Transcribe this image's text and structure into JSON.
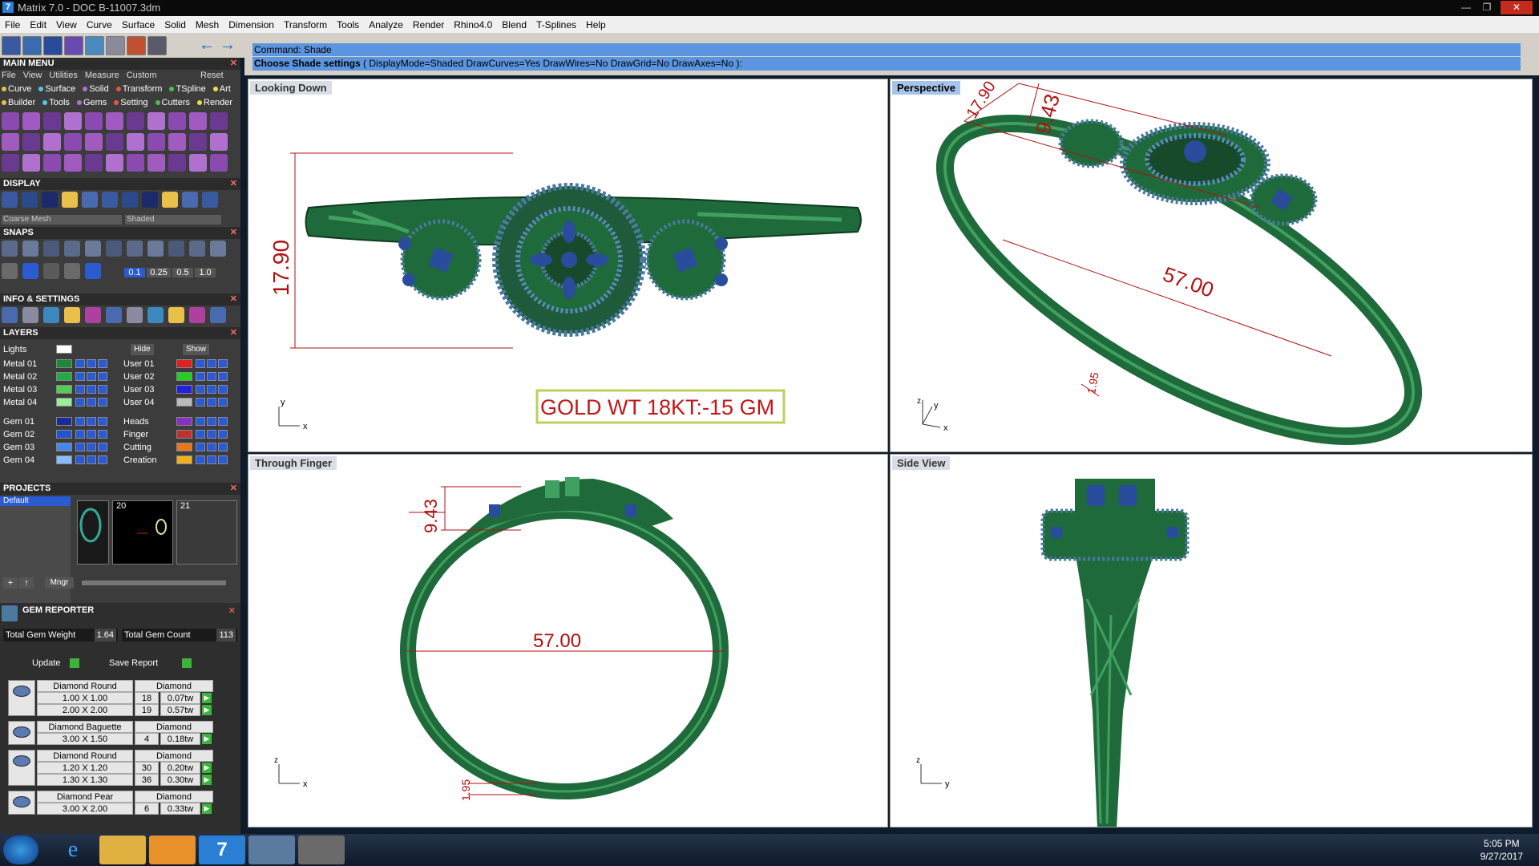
{
  "window": {
    "title": "Matrix 7.0 - DOC B-11007.3dm",
    "app_icon": "matrix-logo-icon",
    "controls": [
      "minimize-icon",
      "restore-icon",
      "close-icon"
    ]
  },
  "menubar": [
    "File",
    "Edit",
    "View",
    "Curve",
    "Surface",
    "Solid",
    "Mesh",
    "Dimension",
    "Transform",
    "Tools",
    "Analyze",
    "Render",
    "Rhino4.0",
    "Blend",
    "T-Splines",
    "Help"
  ],
  "toolbar": {
    "icons": [
      "new-file-icon",
      "open-file-icon",
      "render-icon",
      "curve-icon",
      "shade-icon",
      "viewport-icon",
      "gem-icon",
      "tool-icon"
    ],
    "nav": [
      "back-arrow-icon",
      "forward-arrow-icon"
    ]
  },
  "command": {
    "line1": "Command: Shade",
    "prompt": "Choose Shade settings",
    "options": "( DisplayMode=Shaded  DrawCurves=Yes  DrawWires=No  DrawGrid=No  DrawAxes=No ):"
  },
  "main_menu": {
    "title": "MAIN MENU",
    "tabs": [
      "File",
      "View",
      "Utilities",
      "Measure",
      "Custom"
    ],
    "reset": "Reset",
    "builders_row1": [
      "Curve",
      "Surface",
      "Solid",
      "Transform",
      "TSpline",
      "Art"
    ],
    "builders_row2": [
      "Builder",
      "Tools",
      "Gems",
      "Setting",
      "Cutters",
      "Render"
    ],
    "dot_colors": [
      "#e8c04a",
      "#57c6e0",
      "#b070d0",
      "#e05a3a",
      "#4ac04a",
      "#e8e04a"
    ]
  },
  "display": {
    "title": "DISPLAY",
    "mesh_select": "Coarse Mesh",
    "shade_select": "Shaded"
  },
  "snaps": {
    "title": "SNAPS",
    "values": [
      "0.1",
      "0.25",
      "0.5",
      "1.0"
    ]
  },
  "info_settings": {
    "title": "INFO & SETTINGS"
  },
  "layers": {
    "title": "LAYERS",
    "lights": "Lights",
    "hide": "Hide",
    "show": "Show",
    "left": [
      {
        "name": "Metal 01",
        "color": "#1a8a3a"
      },
      {
        "name": "Metal 02",
        "color": "#22aa44"
      },
      {
        "name": "Metal 03",
        "color": "#55cc55"
      },
      {
        "name": "Metal 04",
        "color": "#99ee99"
      },
      {
        "name": "Gem 01",
        "color": "#1a2a99"
      },
      {
        "name": "Gem 02",
        "color": "#2255cc"
      },
      {
        "name": "Gem 03",
        "color": "#4488ee"
      },
      {
        "name": "Gem 04",
        "color": "#88bbff"
      }
    ],
    "right": [
      {
        "name": "User 01",
        "color": "#e02020"
      },
      {
        "name": "User 02",
        "color": "#20d020"
      },
      {
        "name": "User 03",
        "color": "#2020e0"
      },
      {
        "name": "User 04",
        "color": "#bbbbbb"
      },
      {
        "name": "Heads",
        "color": "#8830c0"
      },
      {
        "name": "Finger",
        "color": "#c03030"
      },
      {
        "name": "Cutting",
        "color": "#e87820"
      },
      {
        "name": "Creation",
        "color": "#f0b020"
      }
    ]
  },
  "projects": {
    "title": "PROJECTS",
    "default": "Default",
    "thumb2": "20",
    "thumb3": "21",
    "mngr": "Mngr"
  },
  "gem_reporter": {
    "title": "GEM REPORTER",
    "total_weight_label": "Total Gem Weight",
    "total_weight": "1.64",
    "total_count_label": "Total Gem Count",
    "total_count": "113",
    "update": "Update",
    "save_report": "Save Report",
    "groups": [
      {
        "shape": "Diamond Round",
        "material": "Diamond",
        "icon": "round-gem-icon",
        "rows": [
          {
            "size": "1.00 X 1.00",
            "count": "18",
            "tw": "0.07tw"
          },
          {
            "size": "2.00 X 2.00",
            "count": "19",
            "tw": "0.57tw"
          }
        ]
      },
      {
        "shape": "Diamond Baguette",
        "material": "Diamond",
        "icon": "baguette-gem-icon",
        "rows": [
          {
            "size": "3.00 X 1.50",
            "count": "4",
            "tw": "0.18tw"
          }
        ]
      },
      {
        "shape": "Diamond Round",
        "material": "Diamond",
        "icon": "round-gem-icon",
        "rows": [
          {
            "size": "1.20 X 1.20",
            "count": "30",
            "tw": "0.20tw"
          },
          {
            "size": "1.30 X 1.30",
            "count": "36",
            "tw": "0.30tw"
          }
        ]
      },
      {
        "shape": "Diamond Pear",
        "material": "Diamond",
        "icon": "pear-gem-icon",
        "rows": [
          {
            "size": "3.00 X 2.00",
            "count": "6",
            "tw": "0.33tw"
          }
        ]
      }
    ]
  },
  "viewports": {
    "top": {
      "label": "Looking Down",
      "dim_height": "17.90",
      "gold_note": "GOLD WT 18KT:-15 GM",
      "axis_x": "x",
      "axis_y": "y"
    },
    "perspective": {
      "label": "Perspective",
      "dim1": "17.90",
      "dim2": "9.43",
      "dim3": "57.00",
      "dim4": "1.95",
      "axis_x": "x",
      "axis_y": "y",
      "axis_z": "z"
    },
    "front": {
      "label": "Through Finger",
      "dim_top": "9.43",
      "dim_width": "57.00",
      "dim_band": "1.95",
      "axis_x": "x",
      "axis_z": "z"
    },
    "side": {
      "label": "Side View",
      "axis_y": "y",
      "axis_z": "z"
    }
  },
  "colors": {
    "metal_green": "#1f6a3a",
    "metal_highlight": "#3fa060",
    "gem_blue": "#2a4c9c",
    "dimension_red": "#b01010"
  },
  "taskbar": {
    "apps": [
      "windows-start-icon",
      "internet-explorer-icon",
      "file-explorer-icon",
      "media-player-icon",
      "matrix-taskbar-icon",
      "window-taskbar-icon",
      "tools-taskbar-icon"
    ],
    "time": "5:05 PM",
    "date": "9/27/2017"
  }
}
